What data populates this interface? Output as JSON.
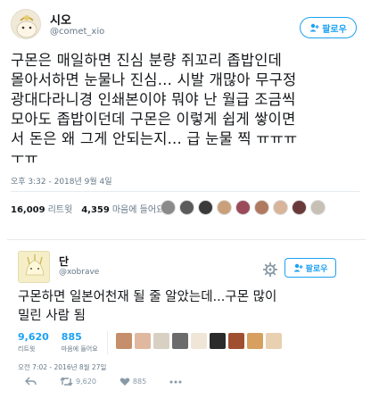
{
  "tweet1": {
    "name": "시오",
    "handle": "@comet_xio",
    "follow_label": "팔로우",
    "text_lines": [
      "구몬은 매일하면 진심 분량 쥐꼬리 좁밥인데",
      "몰아서하면 눈물나 진심... 시발 개많아 무구정",
      "광대다라니경 인쇄본이야 뭐야 난 월급 조금씩",
      "모아도 좁밥이던데 구몬은 이렇게 쉽게 쌓이면",
      "서 돈은 왜 그게 안되는지... 급 눈물 찍 ㅠㅠㅠ",
      "ㅜㅠ"
    ],
    "timestamp": "오후 3:32 - 2018년 9월 4일",
    "retweets_count": "16,009",
    "retweets_label": "리트윗",
    "likes_count": "4,359",
    "likes_label": "마음에 들어요",
    "liker_colors": [
      "#8a8a8a",
      "#5b5b5b",
      "#3a3a3a",
      "#c9a07a",
      "#9a4a5a",
      "#b07a60",
      "#d8b49a",
      "#6a3a3a",
      "#c7c0b5"
    ]
  },
  "tweet2": {
    "name": "단",
    "handle": "@xobrave",
    "follow_label": "팔로우",
    "text_lines": [
      "구몬하면 일본어천재 될 줄 알았는데...구몬 많이",
      "밀린 사람 됨"
    ],
    "retweets_count": "9,620",
    "retweets_label": "리트윗",
    "likes_count": "885",
    "likes_label": "마음에 들어요",
    "liker_colors": [
      "#c48f6a",
      "#e0b8a0",
      "#d9d0c4",
      "#6b6b6b",
      "#f0e6d8",
      "#2b2b2b",
      "#a05030",
      "#d8a060",
      "#e8d0b0"
    ],
    "timestamp": "오전 7:02 - 2016년 8월 27일",
    "action_retweet_count": "9,620",
    "action_like_count": "885"
  }
}
